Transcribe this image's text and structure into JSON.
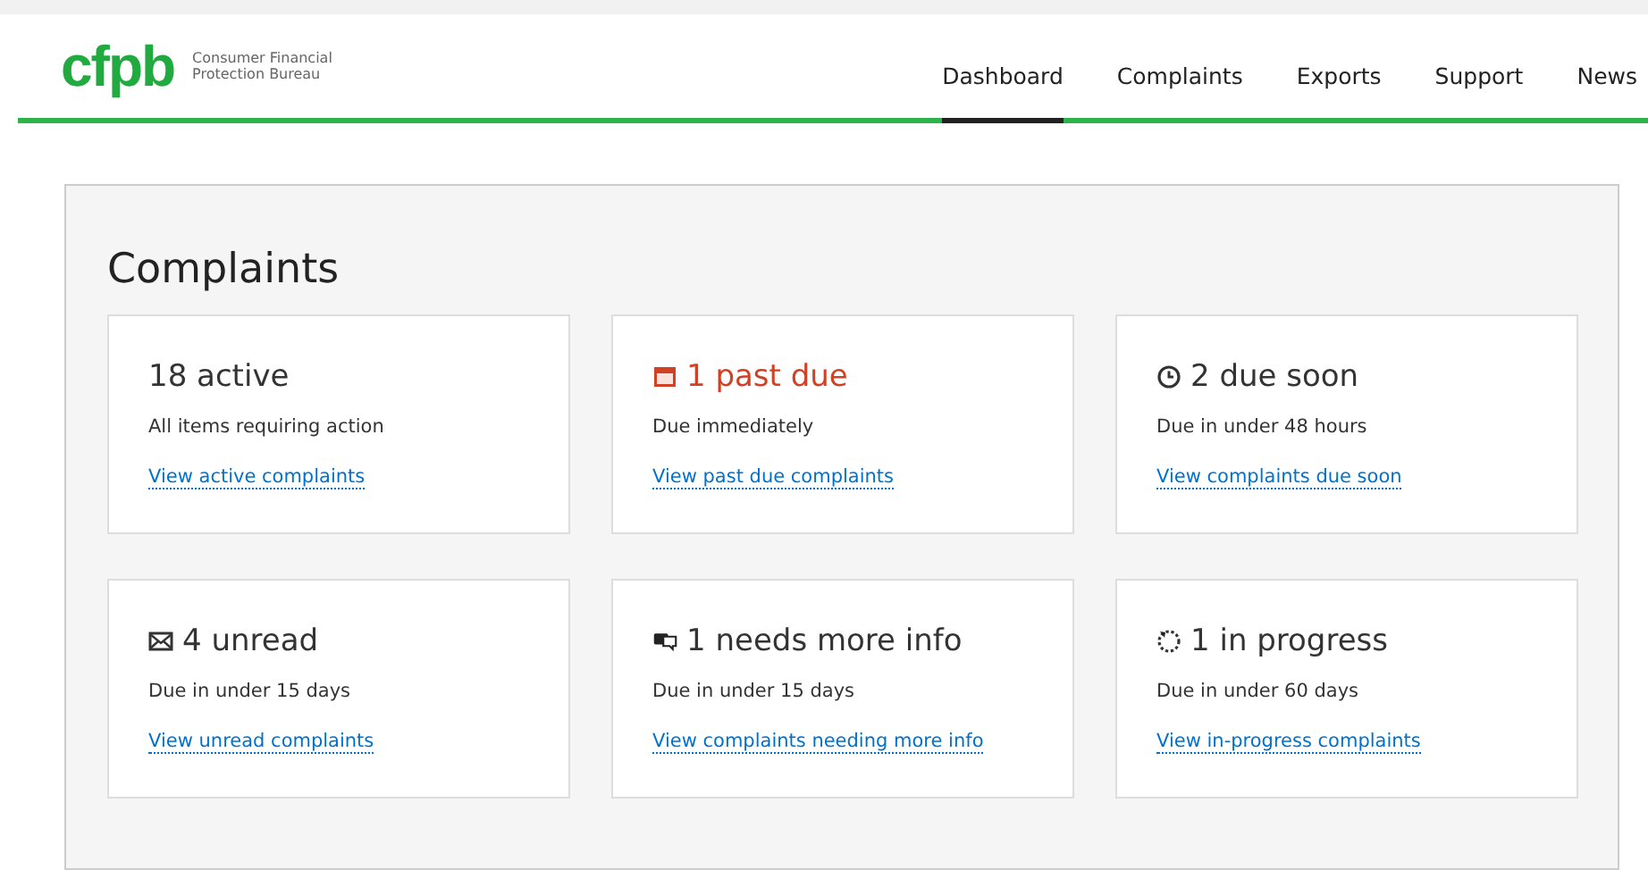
{
  "header": {
    "logo": "cfpb",
    "agency": "Consumer Financial Protection Bureau",
    "nav": [
      {
        "label": "Dashboard",
        "selected": true
      },
      {
        "label": "Complaints",
        "selected": false
      },
      {
        "label": "Exports",
        "selected": false
      },
      {
        "label": "Support",
        "selected": false
      },
      {
        "label": "News",
        "selected": false
      }
    ]
  },
  "panel": {
    "title": "Complaints",
    "cards": [
      {
        "kind": "none",
        "headline": "18 active",
        "alert": false,
        "note": "All items requiring action",
        "link": "View active complaints"
      },
      {
        "kind": "calendar",
        "headline": "1 past due",
        "alert": true,
        "note": "Due immediately",
        "link": "View past due complaints"
      },
      {
        "kind": "clock",
        "headline": "2 due soon",
        "alert": false,
        "note": "Due in under 48 hours",
        "link": "View complaints due soon"
      },
      {
        "kind": "envelope",
        "headline": "4 unread",
        "alert": false,
        "note": "Due in under 15 days",
        "link": "View unread complaints"
      },
      {
        "kind": "chat",
        "headline": "1 needs more info",
        "alert": false,
        "note": "Due in under 15 days",
        "link": "View complaints needing more info"
      },
      {
        "kind": "progress",
        "headline": "1 in progress",
        "alert": false,
        "note": "Due in under 60 days",
        "link": "View in-progress complaints"
      }
    ]
  }
}
